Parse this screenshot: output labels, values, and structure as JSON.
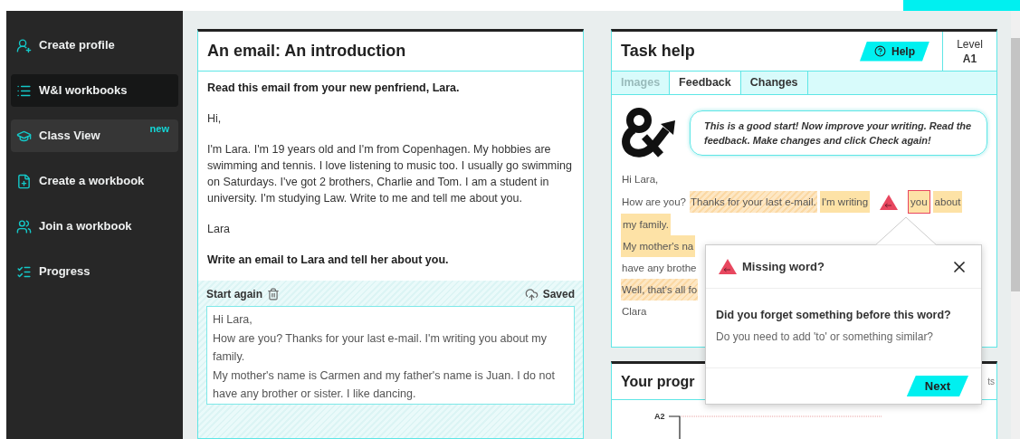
{
  "sidebar": {
    "items": [
      {
        "kind": "profile",
        "label": "Create profile",
        "selected": false,
        "hovered": false
      },
      {
        "kind": "list",
        "label": "W&I workbooks",
        "selected": true,
        "hovered": false
      },
      {
        "kind": "class",
        "label": "Class View",
        "selected": false,
        "hovered": true,
        "badge": "new"
      },
      {
        "kind": "create",
        "label": "Create a workbook",
        "selected": false,
        "hovered": false
      },
      {
        "kind": "join",
        "label": "Join a workbook",
        "selected": false,
        "hovered": false
      },
      {
        "kind": "progress",
        "label": "Progress",
        "selected": false,
        "hovered": false
      }
    ]
  },
  "email_card": {
    "title": "An email: An introduction",
    "instruction": "Read this email from your new penfriend, Lara.",
    "paragraphs": [
      "Hi,",
      "I'm Lara. I'm 19 years old and I'm from Copenhagen. My hobbies are swimming and tennis. I love listening to music too. I usually go swimming on Saturdays. I've got 2 brothers, Charlie and Tom. I am a student in university. I'm studying Law. Write to me and tell me about you.",
      "Lara"
    ],
    "task": "Write an email to Lara and tell her about you."
  },
  "editor": {
    "start_again": "Start again",
    "saved": "Saved",
    "lines": [
      "Hi Lara,",
      "How are you? Thanks for your last e-mail. I'm writing you about my family.",
      "My mother's name is Carmen and my father's name is Juan. I do not have any brother or sister. I like dancing."
    ]
  },
  "task_help": {
    "title": "Task help",
    "help_button": "Help",
    "level_label": "Level",
    "level_value": "A1",
    "tabs": [
      {
        "label": "Images",
        "selected": false,
        "disabled": true
      },
      {
        "label": "Feedback",
        "selected": true,
        "disabled": false
      },
      {
        "label": "Changes",
        "selected": false,
        "disabled": false
      }
    ],
    "bubble": "This is a good start! Now improve your writing. Read the feedback. Make changes and click Check again!",
    "lines": [
      [
        {
          "kind": "plain",
          "text": "Hi Lara,"
        }
      ],
      [
        {
          "kind": "plain",
          "text": "How are you?"
        },
        {
          "kind": "suggestion",
          "text": "Thanks for your last e-mail."
        },
        {
          "kind": "error",
          "text": "I'm writing"
        },
        {
          "kind": "missing"
        },
        {
          "kind": "flagged",
          "text": "you"
        },
        {
          "kind": "error",
          "text": "about"
        }
      ],
      [
        {
          "kind": "error",
          "text": "my family."
        }
      ],
      [
        {
          "kind": "error",
          "text": "My mother's na"
        }
      ],
      [
        {
          "kind": "plain",
          "text": "have any brothe"
        }
      ],
      [
        {
          "kind": "suggestion",
          "text": "Well, that's all fo"
        }
      ],
      [
        {
          "kind": "plain",
          "text": "Clara"
        }
      ]
    ]
  },
  "popup": {
    "title": "Missing word?",
    "question": "Did you forget something before this word?",
    "hint": "Do you need to add 'to' or something similar?",
    "next": "Next"
  },
  "progress_card": {
    "title": "Your progr",
    "side_label": "ts",
    "axis_label": "A2"
  }
}
